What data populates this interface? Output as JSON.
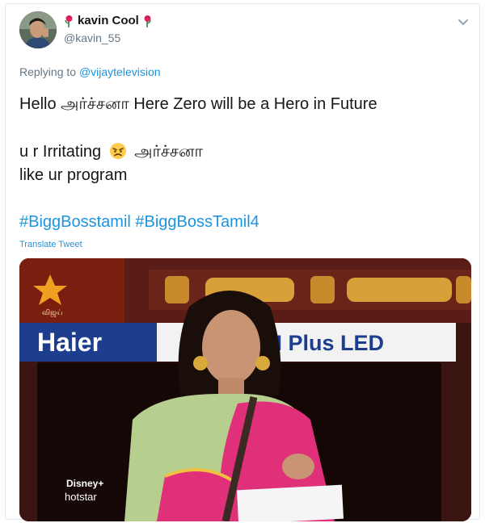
{
  "tweet": {
    "display_name": "kavin Cool",
    "username": "@kavin_55",
    "replying_prefix": "Replying to",
    "replying_handle": "@vijaytelevision",
    "line1": "Hello அர்ச்சனா Here Zero will be a Hero in Future",
    "line2_a": "u r Irritating",
    "line2_b": "அர்ச்சனா",
    "line3": "like ur program",
    "hashtags": "#BiggBosstamil #BiggBossTamil4",
    "translate_label": "Translate Tweet"
  },
  "media": {
    "banner_left": "Haier",
    "banner_right": "AI Plus LED",
    "logo_caption": "விஜய்",
    "watermark_top": "Disney+",
    "watermark_bottom": "hotstar"
  },
  "icons": {
    "chevron": "chevron-down-icon",
    "rose": "rose-emoji-icon",
    "angry": "angry-face-emoji-icon"
  },
  "colors": {
    "link": "#1b95e0",
    "muted": "#657786",
    "text": "#14171a"
  }
}
